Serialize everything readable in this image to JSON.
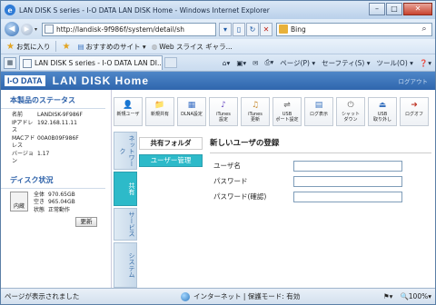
{
  "window": {
    "title": "LAN DISK S series - I-O DATA LAN DISK Home - Windows Internet Explorer"
  },
  "address": {
    "url": "http://landisk-9f986f/system/detail/sh",
    "search_text": "Bing"
  },
  "favorites": {
    "favorites_label": "お気に入り",
    "recommended_label": "おすすめのサイト ▾",
    "webslice_label": "Web スライス ギャラ..."
  },
  "tab": {
    "label": "LAN DISK S series - I-O DATA LAN DI..."
  },
  "commands": {
    "page": "ページ(P) ▾",
    "safety": "セーフティ(S) ▾",
    "tools": "ツール(O) ▾",
    "help": "❓▾"
  },
  "app": {
    "brand": "I-O DATA",
    "product": "LAN DISK Home",
    "logout": "ログアウト"
  },
  "status": {
    "title": "本製品のステータス",
    "rows": [
      {
        "k": "名前",
        "v": "LANDISK-9F986F"
      },
      {
        "k": "IPアドレス",
        "v": "192.168.11.11"
      },
      {
        "k": "MACアドレス",
        "v": "00A0B09F986F"
      },
      {
        "k": "バージョン",
        "v": "1.17"
      }
    ],
    "disk_title": "ディスク状況",
    "disk_icon_label": "内蔵",
    "disk_rows": [
      {
        "k": "全体",
        "v": "970.65GB"
      },
      {
        "k": "空き",
        "v": "965.04GB"
      },
      {
        "k": "状態",
        "v": "正常動作"
      }
    ],
    "update_button": "更新"
  },
  "toolbar": [
    {
      "label": "新規ユーザ",
      "icon": "user-add-icon",
      "glyph": "👤",
      "color": "#2b8a3e"
    },
    {
      "label": "新規共有",
      "icon": "folder-add-icon",
      "glyph": "📁",
      "color": "#d99a1a"
    },
    {
      "label": "DLNA設定",
      "icon": "dlna-icon",
      "glyph": "▦",
      "color": "#3a6fc4"
    },
    {
      "label": "iTunes\n設定",
      "icon": "itunes-icon",
      "glyph": "♪",
      "color": "#6a4bc4"
    },
    {
      "label": "iTunes\n更新",
      "icon": "itunes-update-icon",
      "glyph": "♫",
      "color": "#c4862a"
    },
    {
      "label": "USB\nポート設定",
      "icon": "usb-port-icon",
      "glyph": "⇌",
      "color": "#555555"
    },
    {
      "label": "ログ表示",
      "icon": "log-icon",
      "glyph": "▤",
      "color": "#3b74c0"
    },
    {
      "label": "シャット\nダウン",
      "icon": "shutdown-icon",
      "glyph": "⏻",
      "color": "#666666"
    },
    {
      "label": "USB\n取り外し",
      "icon": "usb-remove-icon",
      "glyph": "⏏",
      "color": "#3b74c0"
    },
    {
      "label": "ログオフ",
      "icon": "logoff-icon",
      "glyph": "➜",
      "color": "#c03a2b"
    }
  ],
  "vtabs": [
    "ネットワーク",
    "共有",
    "サービス",
    "システム"
  ],
  "sidenav": [
    "共有フォルダ",
    "ユーザー管理"
  ],
  "form": {
    "title": "新しいユーザの登録",
    "fields": [
      {
        "label": "ユーザ名",
        "value": ""
      },
      {
        "label": "パスワード",
        "value": ""
      },
      {
        "label": "パスワード(確認)",
        "value": ""
      }
    ]
  },
  "statusbar": {
    "left": "ページが表示されました",
    "zone": "インターネット | 保護モード: 有効",
    "zoom": "100%"
  }
}
